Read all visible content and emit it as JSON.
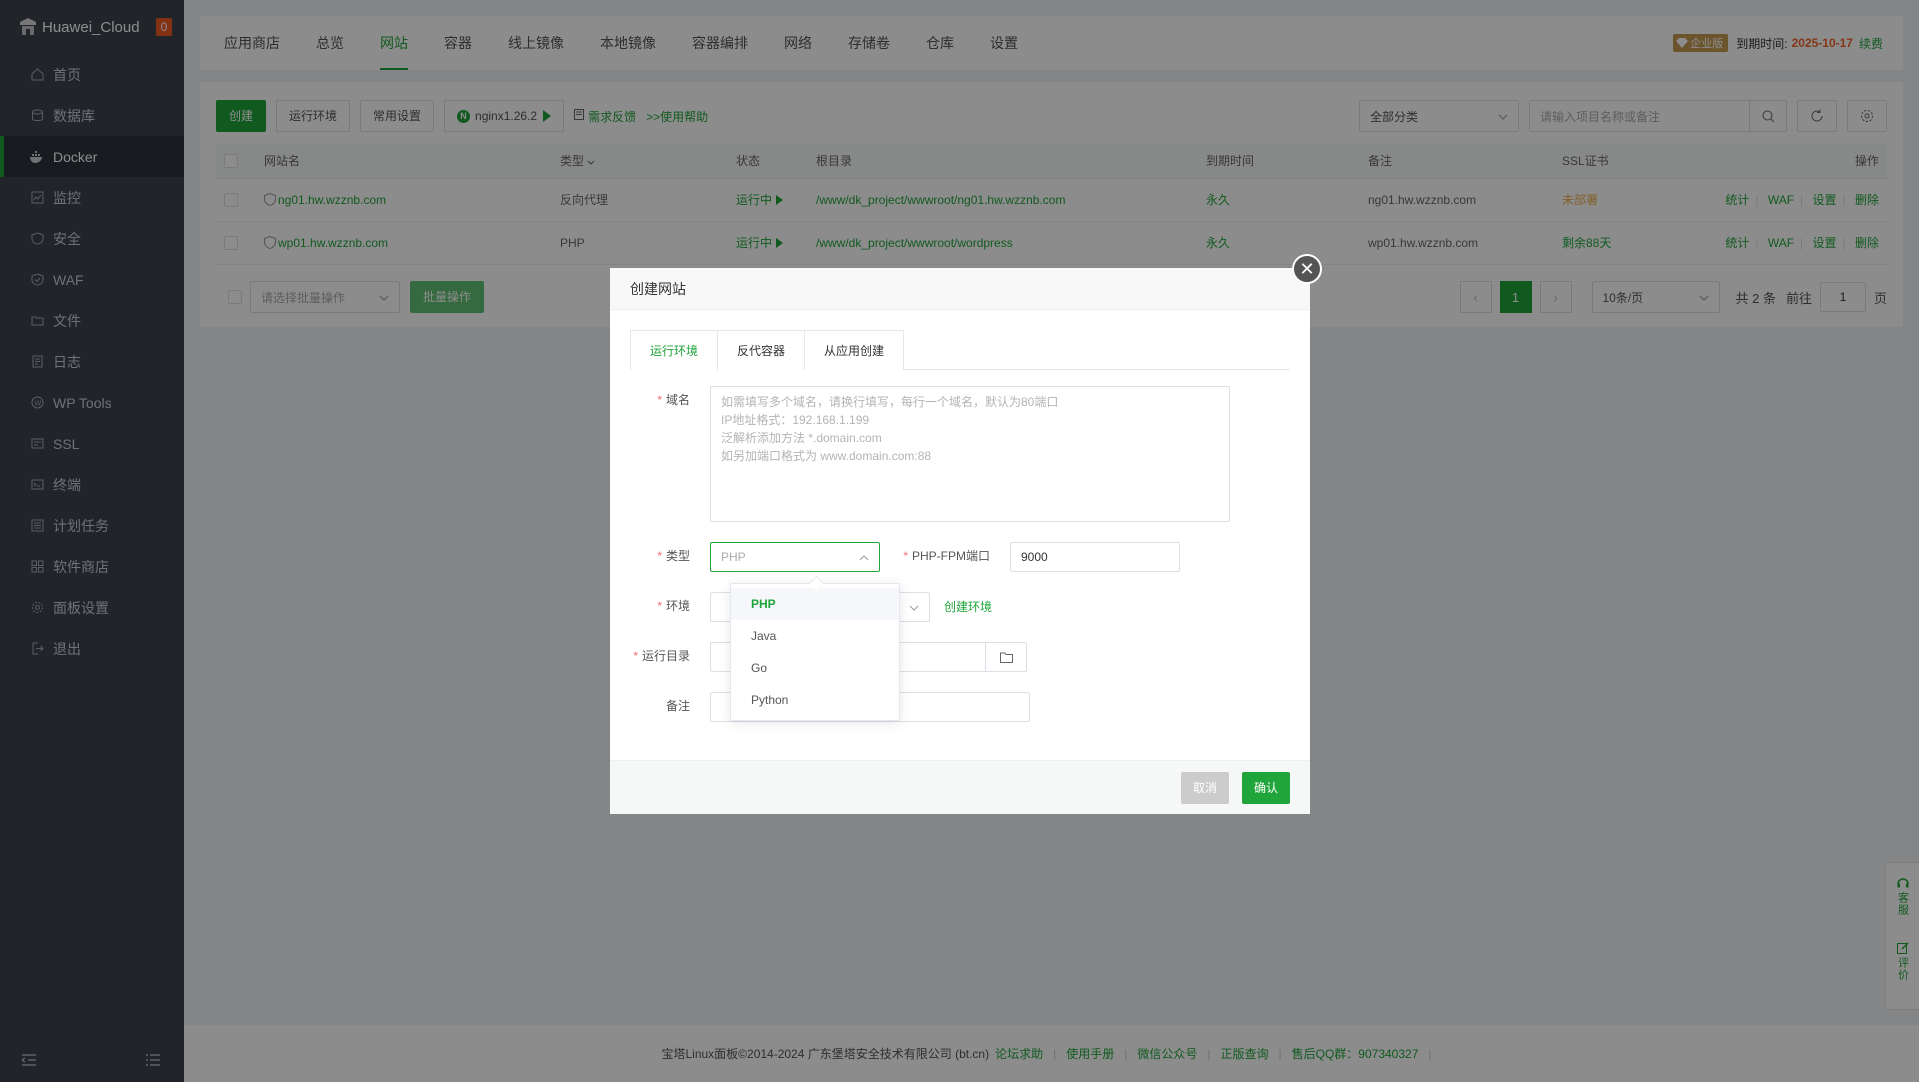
{
  "sidebar": {
    "brand": "Huawei_Cloud",
    "badge": "0",
    "items": [
      {
        "label": "首页"
      },
      {
        "label": "数据库"
      },
      {
        "label": "Docker"
      },
      {
        "label": "监控"
      },
      {
        "label": "安全"
      },
      {
        "label": "WAF"
      },
      {
        "label": "文件"
      },
      {
        "label": "日志"
      },
      {
        "label": "WP Tools"
      },
      {
        "label": "SSL"
      },
      {
        "label": "终端"
      },
      {
        "label": "计划任务"
      },
      {
        "label": "软件商店"
      },
      {
        "label": "面板设置"
      },
      {
        "label": "退出"
      }
    ]
  },
  "topbar": {
    "tabs": [
      "应用商店",
      "总览",
      "网站",
      "容器",
      "线上镜像",
      "本地镜像",
      "容器编排",
      "网络",
      "存储卷",
      "仓库",
      "设置"
    ],
    "edition": "企业版",
    "expire_label": "到期时间:",
    "expire_date": "2025-10-17",
    "renew": "续费"
  },
  "toolbar": {
    "create": "创建",
    "runtime": "运行环境",
    "common_settings": "常用设置",
    "nginx": "nginx1.26.2",
    "feedback": "需求反馈",
    "help": ">>使用帮助",
    "category": "全部分类",
    "search_placeholder": "请输入项目名称或备注"
  },
  "table": {
    "headers": [
      "网站名",
      "类型",
      "状态",
      "根目录",
      "到期时间",
      "备注",
      "SSL证书",
      "操作"
    ],
    "rows": [
      {
        "name": "ng01.hw.wzznb.com",
        "type": "反向代理",
        "status": "运行中",
        "root": "/www/dk_project/wwwroot/ng01.hw.wzznb.com",
        "expire": "永久",
        "note": "ng01.hw.wzznb.com",
        "ssl": "未部署"
      },
      {
        "name": "wp01.hw.wzznb.com",
        "type": "PHP",
        "status": "运行中",
        "root": "/www/dk_project/wwwroot/wordpress",
        "expire": "永久",
        "note": "wp01.hw.wzznb.com",
        "ssl": "剩余88天"
      }
    ],
    "ops": [
      "统计",
      "WAF",
      "设置",
      "删除"
    ]
  },
  "bulk": {
    "placeholder": "请选择批量操作",
    "button": "批量操作"
  },
  "pager": {
    "current": "1",
    "page_size": "10条/页",
    "total": "共 2 条",
    "goto": "前往",
    "goto_value": "1",
    "page_suffix": "页"
  },
  "modal": {
    "title": "创建网站",
    "tabs": [
      "运行环境",
      "反代容器",
      "从应用创建"
    ],
    "domain_label": "域名",
    "domain_placeholder": "如需填写多个域名，请换行填写，每行一个域名，默认为80端口\nIP地址格式：192.168.1.199\n泛解析添加方法 *.domain.com\n如另加端口格式为 www.domain.com:88",
    "type_label": "类型",
    "type_value": "PHP",
    "fpm_label": "PHP-FPM端口",
    "fpm_value": "9000",
    "env_label": "环境",
    "create_env": "创建环境",
    "dir_label": "运行目录",
    "note_label": "备注",
    "type_options": [
      "PHP",
      "Java",
      "Go",
      "Python"
    ],
    "cancel": "取消",
    "confirm": "确认"
  },
  "footer": {
    "copyright": "宝塔Linux面板©2014-2024 广东堡塔安全技术有限公司 (bt.cn)",
    "links": [
      "论坛求助",
      "使用手册",
      "微信公众号",
      "正版查询"
    ],
    "qq": "售后QQ群：907340327"
  },
  "side_widget": {
    "service": "客服",
    "review": "评价"
  },
  "colors": {
    "accent": "#20a53a",
    "sidebar": "#3c444d",
    "danger": "#f56c6c"
  }
}
